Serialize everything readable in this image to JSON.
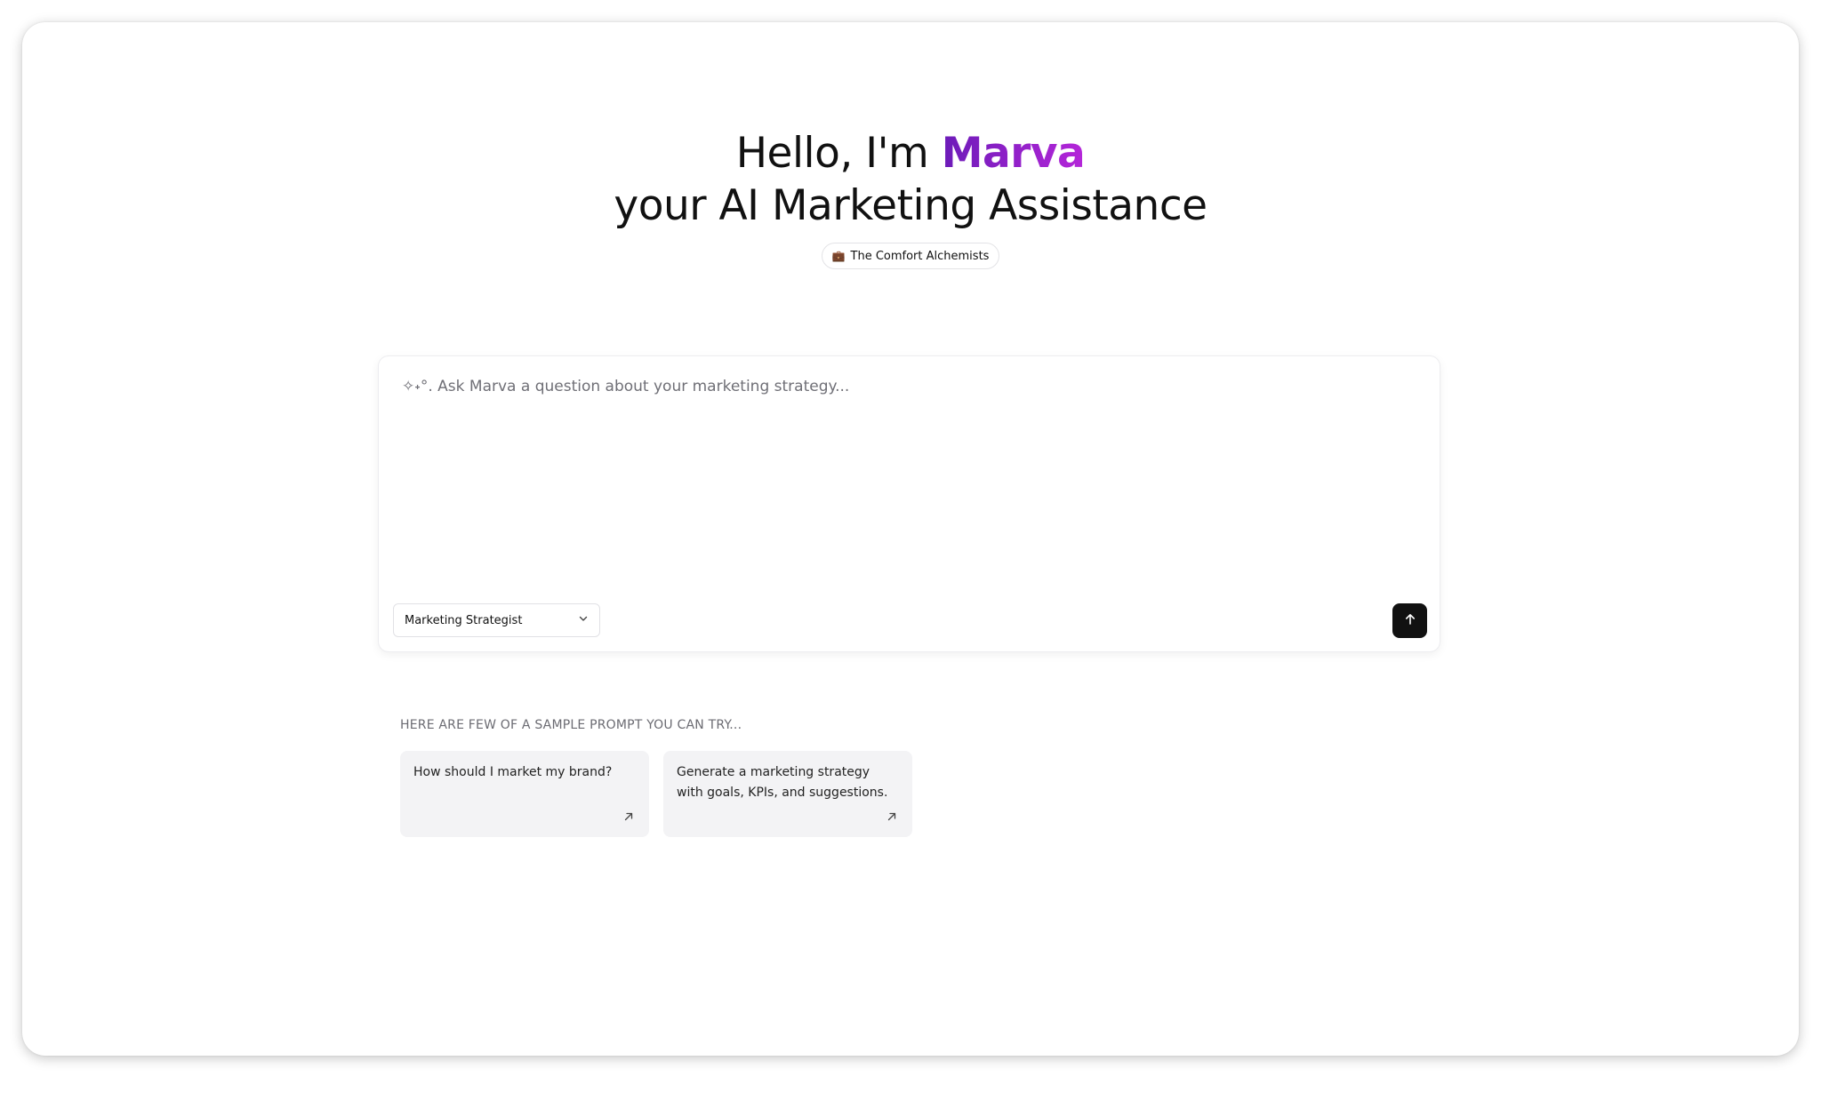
{
  "hero": {
    "greeting": "Hello, I'm ",
    "assistant_name": "Marva",
    "subtitle": "your AI Marketing Assistance"
  },
  "workspace": {
    "icon_glyph": "💼",
    "name": "The Comfort Alchemists"
  },
  "composer": {
    "placeholder": "✧˖°. Ask Marva a question about your marketing strategy...",
    "value": "",
    "model_select": {
      "selected": "Marketing Strategist",
      "icon": "chevron-down-icon"
    },
    "send_icon": "arrow-up-icon"
  },
  "samples": {
    "heading": "HERE ARE FEW OF A SAMPLE PROMPT YOU CAN TRY...",
    "items": [
      {
        "text": "How should I market my brand?",
        "icon": "arrow-up-right-icon"
      },
      {
        "text": "Generate a marketing strategy with goals, KPIs, and suggestions.",
        "icon": "arrow-up-right-icon"
      }
    ]
  },
  "colors": {
    "brand_gradient_start": "#6c1bb8",
    "brand_gradient_end": "#b526d9",
    "send_button": "#111111",
    "sample_card_bg": "#f3f3f5"
  }
}
